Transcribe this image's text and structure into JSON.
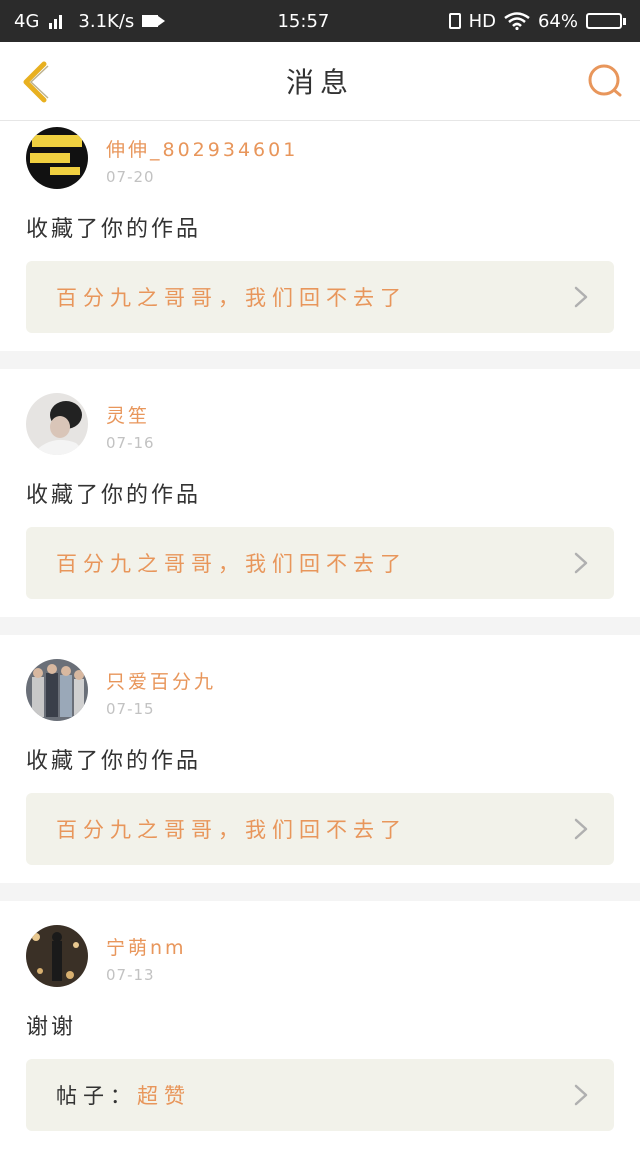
{
  "status_bar": {
    "network": "4G",
    "speed": "3.1K/s",
    "time": "15:57",
    "hd": "HD",
    "battery": "64%",
    "battery_level": 0.64
  },
  "nav": {
    "title": "消息"
  },
  "messages": [
    {
      "username": "伸伸_802934601",
      "date": "07-20",
      "action": "收藏了你的作品",
      "ref_label": "",
      "ref_text": "百分九之哥哥，我们回不去了"
    },
    {
      "username": "灵笙",
      "date": "07-16",
      "action": "收藏了你的作品",
      "ref_label": "",
      "ref_text": "百分九之哥哥，我们回不去了"
    },
    {
      "username": "只爱百分九",
      "date": "07-15",
      "action": "收藏了你的作品",
      "ref_label": "",
      "ref_text": "百分九之哥哥，我们回不去了"
    },
    {
      "username": "宁萌nm",
      "date": "07-13",
      "action": "谢谢",
      "ref_label": "帖子：",
      "ref_text": "超赞"
    }
  ],
  "colors": {
    "accent": "#e8965b",
    "back_arrow": "#e8b020",
    "ref_bg": "#f2f2ea"
  },
  "icons": {
    "back": "chevron-left-icon",
    "search": "search-icon",
    "row_arrow": "chevron-right-icon"
  }
}
